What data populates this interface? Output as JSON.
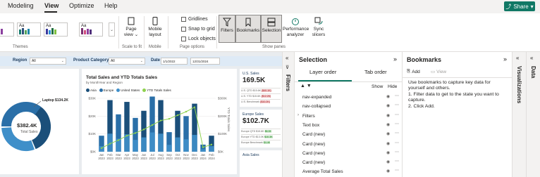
{
  "menu": {
    "items": [
      "Modeling",
      "View",
      "Optimize",
      "Help"
    ],
    "active": "View",
    "share_label": "Share"
  },
  "ribbon": {
    "themes_label": "Themes",
    "theme_thumb_text": "Aa",
    "page_view_label": "Page view",
    "scale_to_fit_label": "Scale to fit",
    "mobile_layout_label": "Mobile layout",
    "mobile_label": "Mobile",
    "gridlines_label": "Gridlines",
    "snap_to_grid_label": "Snap to grid",
    "lock_objects_label": "Lock objects",
    "page_options_label": "Page options",
    "filters_label": "Filters",
    "bookmarks_label": "Bookmarks",
    "selection_label": "Selection",
    "perf_analyzer_label": "Performance analyzer",
    "sync_slicers_label": "Sync slicers",
    "show_panes_label": "Show panes"
  },
  "report": {
    "filters": {
      "region_label": "Region",
      "region_value": "All",
      "product_category_label": "Product Category",
      "product_category_value": "All",
      "date_label": "Date",
      "date_start": "1/1/2022",
      "date_end": "12/31/2024"
    },
    "donut": {
      "value": "$382.4K",
      "label": "Total Sales",
      "callout": "Laptop $134.2K"
    },
    "kpis": [
      {
        "title": "U.S. Sales",
        "value": "169.5K",
        "rows": [
          {
            "text": "U.S. QTD $15.6K",
            "delta": "($40.1K)",
            "kind": "neg"
          },
          {
            "text": "U.S. YTD $15.6K",
            "delta": "($12.2K)",
            "kind": "neg"
          },
          {
            "text": "U.S. Benchmark",
            "delta": "($10.2K)",
            "kind": "neg"
          }
        ]
      },
      {
        "title": "Europe Sales",
        "value": "$102.7K",
        "rows": [
          {
            "text": "Europe QTD $15.6K",
            "delta": "$6.0K",
            "kind": "pos"
          },
          {
            "text": "Europe YTD $13.0K",
            "delta": "$10.3K",
            "kind": "pos"
          },
          {
            "text": "Europe Benchmark",
            "delta": "$4.4K",
            "kind": "pos"
          }
        ]
      },
      {
        "title": "Asia Sales",
        "value": "",
        "rows": []
      }
    ]
  },
  "chart_data": {
    "type": "bar",
    "title": "Total Sales and YTD Totals Sales",
    "subtitle": "by MonthYear and Region",
    "legend": [
      "Asia",
      "Europe",
      "United States",
      "YTD Totals Sales"
    ],
    "colors": {
      "Asia": "#1b4f7a",
      "Europe": "#2a6fa8",
      "United States": "#3f8fc9",
      "YTD Totals Sales": "#8fd14f"
    },
    "categories": [
      "Jan",
      "Feb",
      "Mar",
      "Apr",
      "May",
      "Jun",
      "Jul",
      "Aug",
      "Sep",
      "Oct",
      "Nov",
      "Dec",
      "Jan",
      "Feb"
    ],
    "category_years": [
      "2023",
      "2023",
      "2023",
      "2023",
      "2023",
      "2023",
      "2023",
      "2023",
      "2023",
      "2023",
      "2023",
      "2023",
      "2024",
      "2024"
    ],
    "series": [
      {
        "name": "Total Sales",
        "values": [
          9,
          29,
          21,
          28,
          19,
          23,
          31,
          29,
          11,
          23,
          20,
          27,
          4,
          9
        ]
      },
      {
        "name": "YTD Totals Sales",
        "values": [
          20,
          45,
          65,
          90,
          105,
          125,
          150,
          175,
          185,
          205,
          225,
          250,
          25,
          40
        ],
        "axis": "secondary"
      }
    ],
    "ylim": [
      0,
      30
    ],
    "y_ticks": [
      "$0K",
      "$10K",
      "$20K",
      "$30K"
    ],
    "y2lim": [
      0,
      300
    ],
    "y2_ticks": [
      "$0K",
      "$100K",
      "$200K",
      "$300K"
    ],
    "y2label": "YTD Totals Sales"
  },
  "selection_pane": {
    "title": "Selection",
    "tabs": [
      "Layer order",
      "Tab order"
    ],
    "show_label": "Show",
    "hide_label": "Hide",
    "items": [
      {
        "label": "nav-expanded",
        "expandable": false
      },
      {
        "label": "nav-collapsed",
        "expandable": false
      },
      {
        "label": "Filters",
        "expandable": true
      },
      {
        "label": "Text box",
        "expandable": false
      },
      {
        "label": "Card (new)",
        "expandable": false
      },
      {
        "label": "Card (new)",
        "expandable": false
      },
      {
        "label": "Card (new)",
        "expandable": false
      },
      {
        "label": "Card (new)",
        "expandable": false
      },
      {
        "label": "Average Total Sales",
        "expandable": false
      }
    ]
  },
  "bookmarks_pane": {
    "title": "Bookmarks",
    "add_label": "Add",
    "view_label": "View",
    "help_lines": [
      "Use bookmarks to capture key data for yourself and others.",
      "1. Filter data to get to the state you want to capture.",
      "2. Click Add."
    ]
  },
  "side_panes": {
    "filters_label": "Filters",
    "visualizations_label": "Visualizations",
    "data_label": "Data"
  }
}
